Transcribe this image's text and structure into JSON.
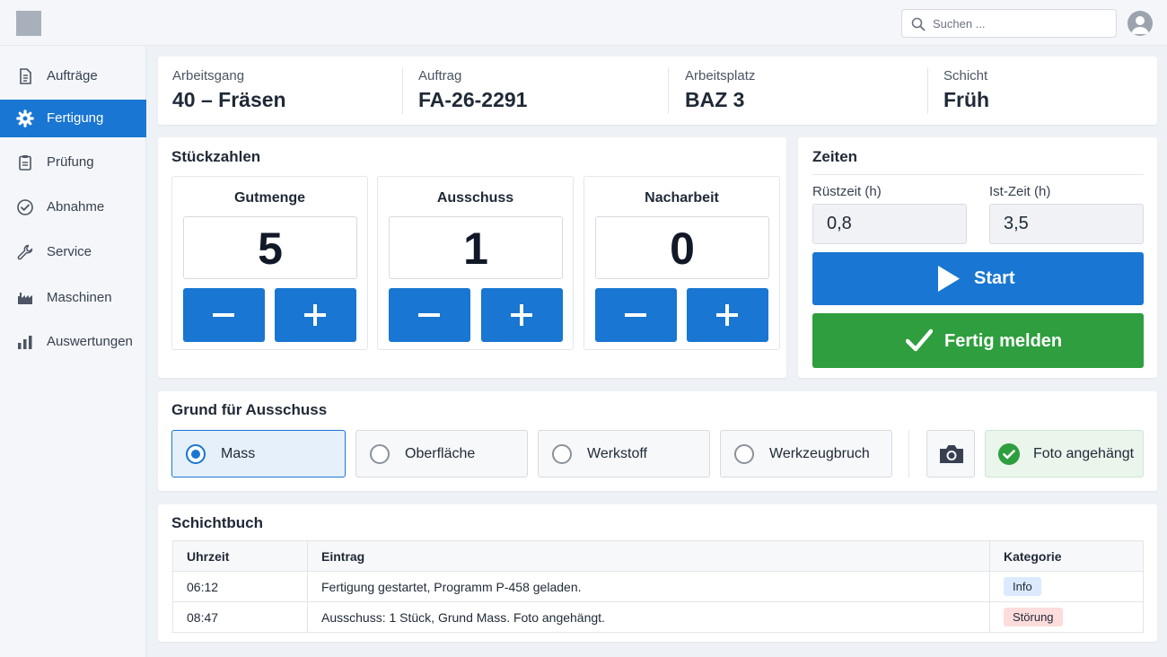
{
  "header": {
    "search_placeholder": "Suchen ...",
    "search_value": ""
  },
  "sidebar": {
    "items": [
      {
        "label": "Aufträge",
        "icon": "document-icon",
        "active": false
      },
      {
        "label": "Fertigung",
        "icon": "gear-icon",
        "active": true
      },
      {
        "label": "Prüfung",
        "icon": "clipboard-icon",
        "active": false
      },
      {
        "label": "Abnahme",
        "icon": "check-circle-icon",
        "active": false
      },
      {
        "label": "Service",
        "icon": "wrench-icon",
        "active": false
      },
      {
        "label": "Maschinen",
        "icon": "factory-icon",
        "active": false
      },
      {
        "label": "Auswertungen",
        "icon": "bar-chart-icon",
        "active": false
      }
    ]
  },
  "info": [
    {
      "label": "Arbeitsgang",
      "value": "40 – Fräsen"
    },
    {
      "label": "Auftrag",
      "value": "FA-26-2291"
    },
    {
      "label": "Arbeitsplatz",
      "value": "BAZ 3"
    },
    {
      "label": "Schicht",
      "value": "Früh"
    }
  ],
  "quantities": {
    "title": "Stückzahlen",
    "counters": [
      {
        "label": "Gutmenge",
        "value": "5"
      },
      {
        "label": "Ausschuss",
        "value": "1"
      },
      {
        "label": "Nacharbeit",
        "value": "0"
      }
    ]
  },
  "times": {
    "title": "Zeiten",
    "setup_label": "Rüstzeit (h)",
    "setup_value": "0,8",
    "actual_label": "Ist-Zeit (h)",
    "actual_value": "3,5",
    "start_label": "Start",
    "finish_label": "Fertig melden"
  },
  "reject_reason": {
    "title": "Grund für Ausschuss",
    "options": [
      "Mass",
      "Oberfläche",
      "Werkstoff",
      "Werkzeugbruch"
    ],
    "selected": "Mass",
    "photo_status": "Foto angehängt"
  },
  "shiftlog": {
    "title": "Schichtbuch",
    "columns": [
      "Uhrzeit",
      "Eintrag",
      "Kategorie"
    ],
    "rows": [
      {
        "time": "06:12",
        "entry": "Fertigung gestartet, Programm P-458 geladen.",
        "category": "Info"
      },
      {
        "time": "08:47",
        "entry": "Ausschuss: 1 Stück, Grund Mass. Foto angehängt.",
        "category": "Störung"
      }
    ]
  },
  "colors": {
    "primary": "#1976d2",
    "success": "#2e9e3e",
    "info_tag_bg": "#dbeafe",
    "error_tag_bg": "#fddcdc"
  }
}
